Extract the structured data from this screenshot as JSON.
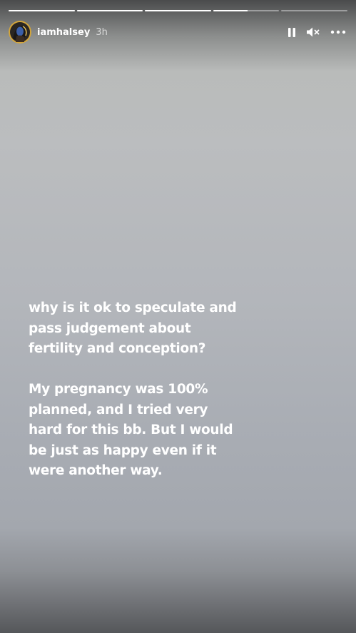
{
  "story": {
    "segments": [
      {
        "progress": 1
      },
      {
        "progress": 1
      },
      {
        "progress": 1
      },
      {
        "progress": 0.52
      },
      {
        "progress": 0
      }
    ],
    "author": {
      "username": "iamhalsey",
      "time": "3h"
    },
    "controls": {
      "pause_icon": "pause-icon",
      "mute_icon": "speaker-muted-icon",
      "more_icon": "more-icon"
    },
    "caption": {
      "paragraph_1": "why is it ok to speculate and pass judgement about fertility and conception?",
      "paragraph_2": "My pregnancy was 100% planned, and I tried very hard for this bb. But I would be just as happy even if it were another way."
    },
    "colors": {
      "text": "#ffffff",
      "background_mid": "#b3b6bb"
    }
  }
}
